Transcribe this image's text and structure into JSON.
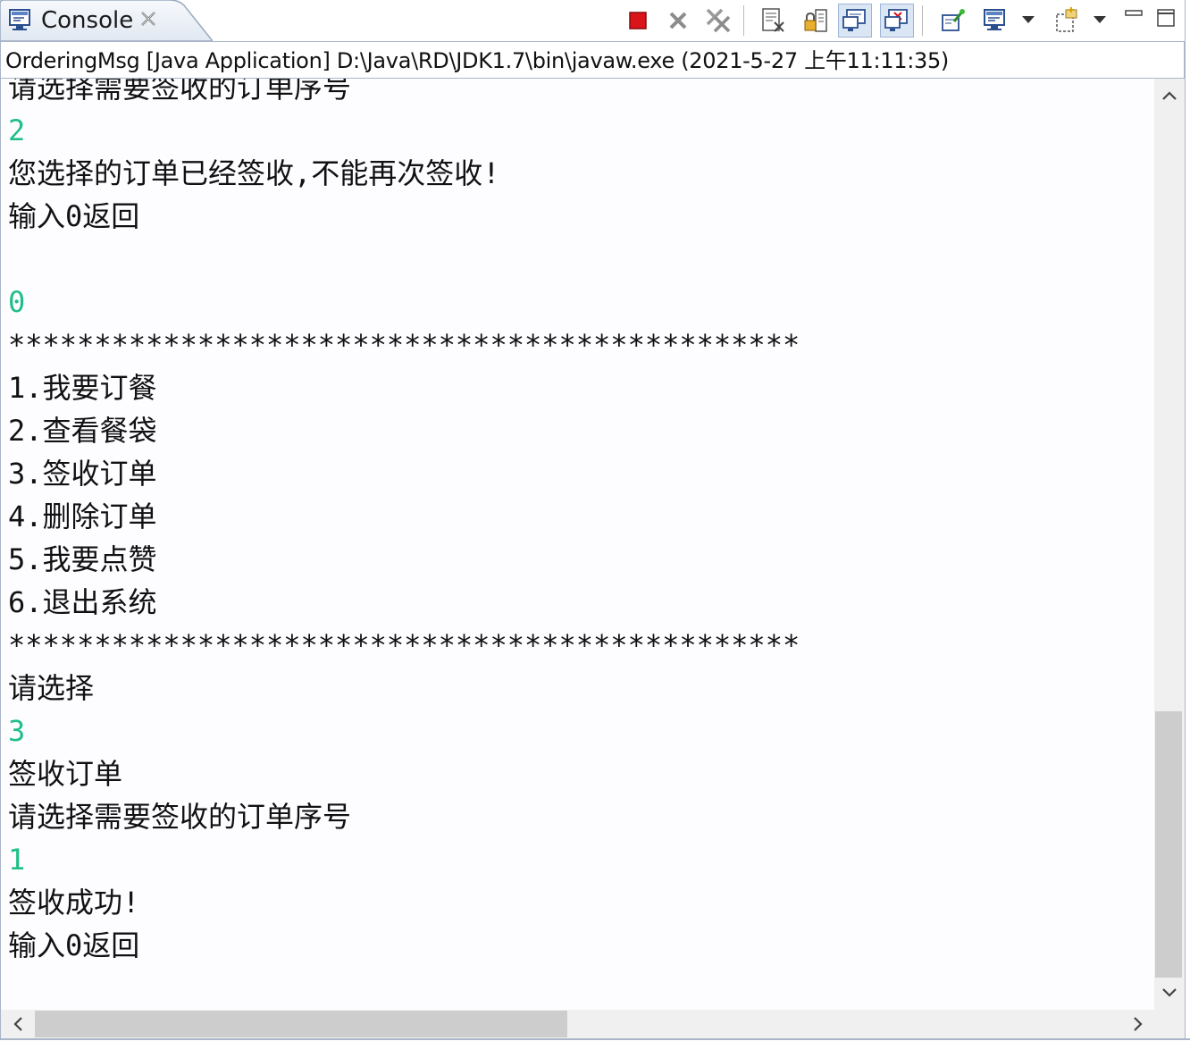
{
  "tab": {
    "title": "Console",
    "icon": "console-icon",
    "close_icon": "close-icon"
  },
  "toolbar": {
    "buttons": [
      {
        "name": "terminate-button",
        "icon": "stop-icon"
      },
      {
        "name": "remove-launch-button",
        "icon": "remove-icon"
      },
      {
        "name": "remove-all-terminated-button",
        "icon": "remove-all-icon"
      },
      {
        "name": "clear-console-button",
        "icon": "clear-console-icon"
      },
      {
        "name": "scroll-lock-button",
        "icon": "scroll-lock-icon"
      },
      {
        "name": "show-on-stdout-button",
        "icon": "show-stdout-icon"
      },
      {
        "name": "show-on-stderr-button",
        "icon": "show-stderr-icon"
      },
      {
        "name": "pin-console-button",
        "icon": "pin-icon"
      },
      {
        "name": "display-console-button",
        "icon": "display-console-icon"
      },
      {
        "name": "open-console-button",
        "icon": "open-console-icon"
      },
      {
        "name": "minimize-button",
        "icon": "minimize-icon"
      },
      {
        "name": "maximize-button",
        "icon": "maximize-icon"
      }
    ]
  },
  "process_label": "OrderingMsg [Java Application] D:\\Java\\RD\\JDK1.7\\bin\\javaw.exe (2021-5-27 上午11:11:35)",
  "console": {
    "lines": [
      {
        "text": "请选择需要签收的订单序号",
        "type": "output"
      },
      {
        "text": "2",
        "type": "input"
      },
      {
        "text": "您选择的订单已经签收,不能再次签收!",
        "type": "output"
      },
      {
        "text": "输入0返回",
        "type": "output"
      },
      {
        "text": "",
        "type": "output"
      },
      {
        "text": "0",
        "type": "input"
      },
      {
        "text": "**********************************************",
        "type": "output"
      },
      {
        "text": "1.我要订餐",
        "type": "output"
      },
      {
        "text": "2.查看餐袋",
        "type": "output"
      },
      {
        "text": "3.签收订单",
        "type": "output"
      },
      {
        "text": "4.删除订单",
        "type": "output"
      },
      {
        "text": "5.我要点赞",
        "type": "output"
      },
      {
        "text": "6.退出系统",
        "type": "output"
      },
      {
        "text": "**********************************************",
        "type": "output"
      },
      {
        "text": "请选择",
        "type": "output"
      },
      {
        "text": "3",
        "type": "input"
      },
      {
        "text": "签收订单",
        "type": "output"
      },
      {
        "text": "请选择需要签收的订单序号",
        "type": "output"
      },
      {
        "text": "1",
        "type": "input"
      },
      {
        "text": "签收成功!",
        "type": "output"
      },
      {
        "text": "输入0返回",
        "type": "output"
      }
    ]
  },
  "colors": {
    "input_text": "#1fbf87",
    "output_text": "#111111",
    "terminate_red": "#d9141b"
  }
}
